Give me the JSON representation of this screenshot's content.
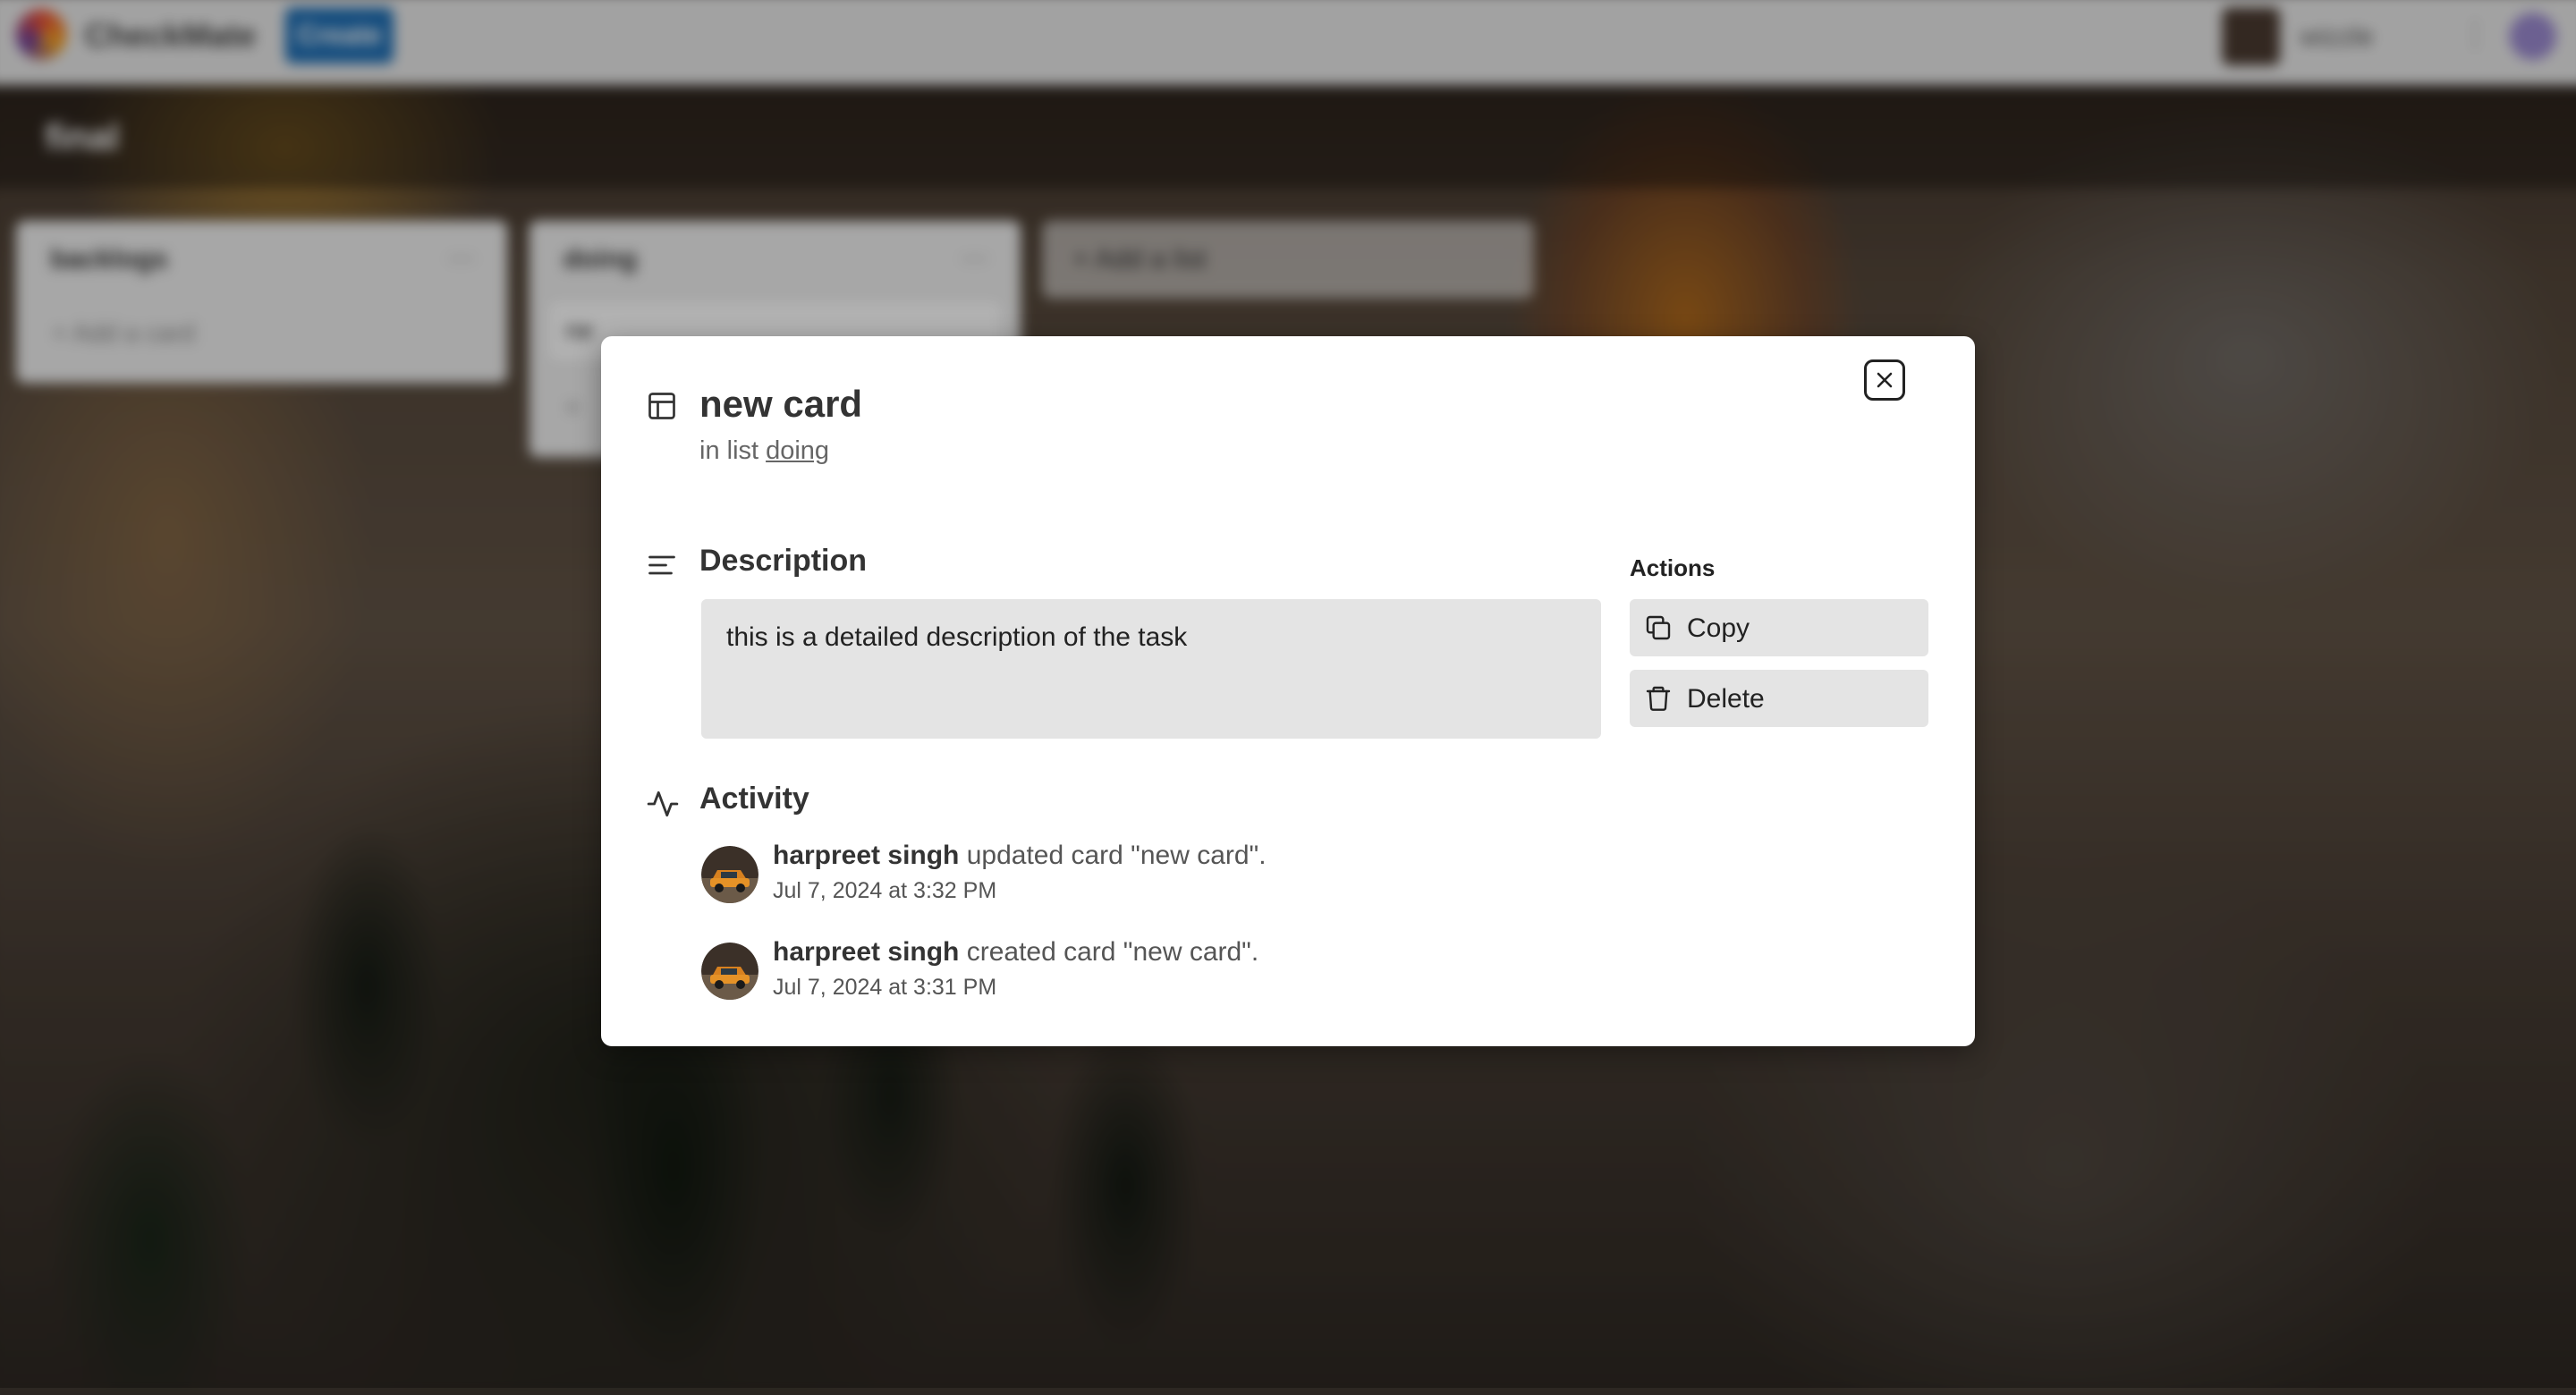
{
  "app": {
    "name": "CheckMate",
    "create_label": "Create",
    "user_name": "wizzle",
    "more_label": "⋮"
  },
  "board": {
    "title": "final",
    "lists": [
      {
        "name": "backlogs",
        "menu": "···",
        "add_card": "+ Add a card",
        "cards": []
      },
      {
        "name": "doing",
        "menu": "···",
        "add_card": "+",
        "cards": [
          "ne"
        ]
      }
    ],
    "add_list_label": "+  Add a list"
  },
  "modal": {
    "title": "new card",
    "in_list_prefix": "in list",
    "list_name": "doing",
    "description_heading": "Description",
    "description_text": "this is a detailed description of the task",
    "actions_heading": "Actions",
    "actions": [
      {
        "label": "Copy",
        "icon": "copy-icon"
      },
      {
        "label": "Delete",
        "icon": "trash-icon"
      }
    ],
    "activity_heading": "Activity",
    "activity": [
      {
        "user": "harpreet singh",
        "text": " updated card \"new card\".",
        "time": "Jul 7, 2024 at 3:32 PM"
      },
      {
        "user": "harpreet singh",
        "text": " created card \"new card\".",
        "time": "Jul 7, 2024 at 3:31 PM"
      }
    ]
  },
  "colors": {
    "primary": "#1f6fb5",
    "modal_bg": "#ffffff",
    "field_bg": "#e4e4e4",
    "text": "#333333"
  }
}
